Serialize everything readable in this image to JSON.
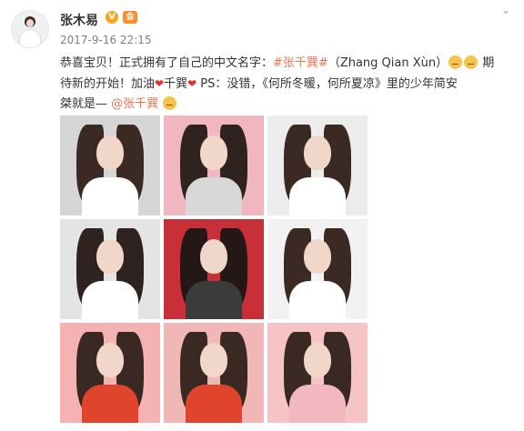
{
  "user": {
    "name": "张木易",
    "verified_badge": "V",
    "member_badge": "会",
    "time": "2017-9-16 22:15"
  },
  "post": {
    "line1_prefix": "恭喜宝贝！正式拥有了自己的中文名字：",
    "topic_link": "#张千巽#",
    "line1_middle": "（Zhang Qian Xùn）",
    "line1_tail": " 期",
    "line2_prefix": "待新的开始！加油",
    "line2_name": "千巽",
    "line2_ps": " PS：没错，《何所冬暖，何所夏凉》里的少年简安",
    "line3_prefix": "桀就是— ",
    "mention_link": "@张千巽"
  },
  "photos": [
    {
      "bg": "#d6d6d6",
      "shirt": "#ffffff",
      "hair": "#3b2a24"
    },
    {
      "bg": "#f0b7c0",
      "shirt": "#d8d8d8",
      "hair": "#2f2320"
    },
    {
      "bg": "#ececec",
      "shirt": "#ffffff",
      "hair": "#3b2a24"
    },
    {
      "bg": "#e4e4e4",
      "shirt": "#ffffff",
      "hair": "#2f2320"
    },
    {
      "bg": "#c92f38",
      "shirt": "#3b3b3b",
      "hair": "#231815"
    },
    {
      "bg": "#f2f2f2",
      "shirt": "#ffffff",
      "hair": "#3b2a24"
    },
    {
      "bg": "#f4b2b2",
      "shirt": "#e0442c",
      "hair": "#3a2923"
    },
    {
      "bg": "#f1b6b6",
      "shirt": "#e0442c",
      "hair": "#3a2923"
    },
    {
      "bg": "#f6c4c4",
      "shirt": "#f2b8c0",
      "hair": "#3a2923"
    }
  ],
  "colors": {
    "link": "#eb7350",
    "time": "#808080"
  }
}
